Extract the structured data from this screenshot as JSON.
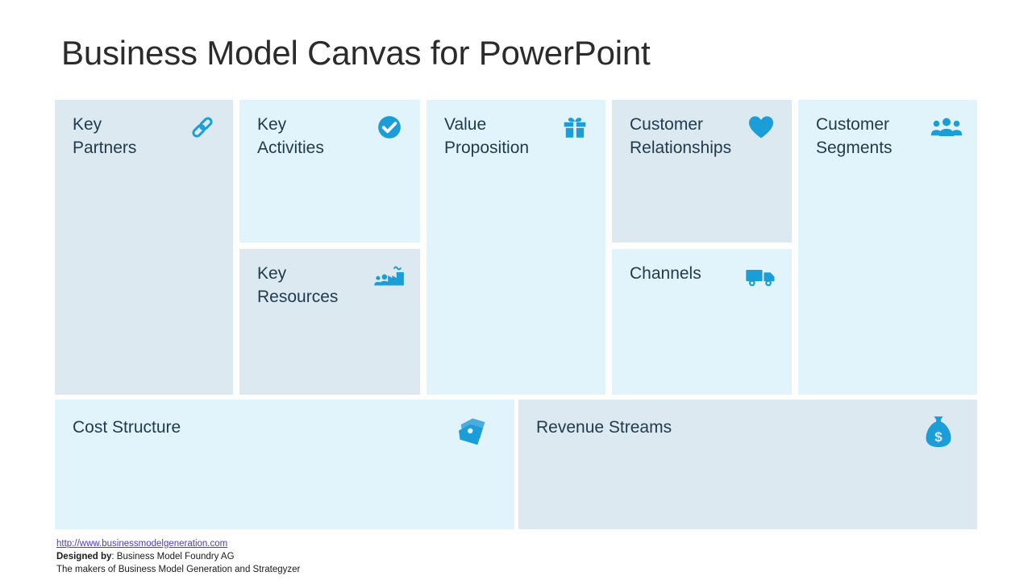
{
  "slide": {
    "title": "Business Model Canvas for PowerPoint",
    "background_color": "#ffffff",
    "accent_color": "#1b9ed8",
    "label_color": "#1f3a4d",
    "card_shade_a": "#dde9f0",
    "card_shade_b": "#e1f4fb"
  },
  "cards": [
    {
      "label": "Key\nPartners",
      "icon": "link-chain-icon",
      "shade": "#dde9f0"
    },
    {
      "label": "Key\nActivities",
      "icon": "check-circle-icon",
      "shade": "#e1f4fb"
    },
    {
      "label": "Key\nResources",
      "icon": "factory-people-icon",
      "shade": "#dde9f0"
    },
    {
      "label": "Value\nProposition",
      "icon": "gift-icon",
      "shade": "#e1f4fb"
    },
    {
      "label": "Customer\nRelationships",
      "icon": "heart-icon",
      "shade": "#dde9f0"
    },
    {
      "label": "Channels",
      "icon": "delivery-truck-icon",
      "shade": "#e1f4fb"
    },
    {
      "label": "Customer\nSegments",
      "icon": "people-group-icon",
      "shade": "#e1f4fb"
    },
    {
      "label": "Cost Structure",
      "icon": "price-tags-icon",
      "shade": "#e1f4fb"
    },
    {
      "label": "Revenue Streams",
      "icon": "money-bag-icon",
      "shade": "#dde9f0"
    }
  ],
  "footer": {
    "url": "http://www.businessmodelgeneration.com",
    "designed_by_label": "Designed by",
    "designed_by_value": ": Business Model Foundry AG",
    "tagline": "The makers of Business Model Generation and Strategyzer"
  }
}
